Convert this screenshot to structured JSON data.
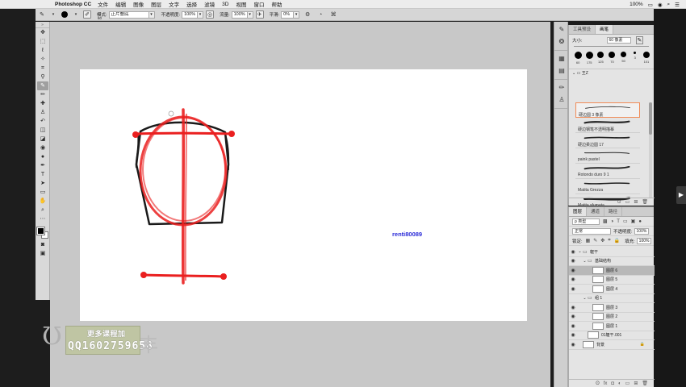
{
  "menubar": {
    "apple": "",
    "app": "Photoshop CC",
    "items": [
      "文件",
      "编辑",
      "图像",
      "图层",
      "文字",
      "选择",
      "滤镜",
      "3D",
      "视图",
      "窗口",
      "帮助"
    ],
    "battery": "100%",
    "status_icons": [
      "◉",
      "≡",
      "⌕",
      "☰"
    ]
  },
  "options": {
    "brush_size": "60",
    "mode_label": "模式:",
    "mode_value": "正片叠底",
    "opacity_label": "不透明度:",
    "opacity_value": "100%",
    "flow_label": "流量:",
    "flow_value": "100%",
    "smooth_label": "平滑:",
    "smooth_value": "0%"
  },
  "canvas": {
    "watermark": "renti80089"
  },
  "promo": {
    "line1": "更多课程加",
    "line2": "QQ1602759658"
  },
  "brush_panel": {
    "tabs": [
      "工具预设",
      "画笔"
    ],
    "active_tab": 1,
    "size_label": "大小:",
    "size_value": "60 像素",
    "presets": [
      {
        "size": "60",
        "d": 9
      },
      {
        "size": "175",
        "d": 9
      },
      {
        "size": "125",
        "d": 8
      },
      {
        "size": "70",
        "d": 8
      },
      {
        "size": "50",
        "d": 7
      },
      {
        "size": "3",
        "d": 3
      },
      {
        "size": "101",
        "d": 8
      }
    ],
    "folder": "王Z",
    "brushes": [
      {
        "name": "硬边圆 3 像素",
        "selected": true
      },
      {
        "name": "硬边钢笔不透明描摹",
        "selected": false
      },
      {
        "name": "硬边柔边圆 17",
        "selected": false
      },
      {
        "name": "paink pastel",
        "selected": false
      },
      {
        "name": "Rotondo duro 9 1",
        "selected": false
      },
      {
        "name": "Matita Grezza",
        "selected": false
      },
      {
        "name": "Matita sfumata",
        "selected": false
      }
    ]
  },
  "layers_panel": {
    "tabs": [
      "图层",
      "通道",
      "路径"
    ],
    "active_tab": 0,
    "filter_label": "ρ 类型",
    "blend_mode": "正常",
    "opacity_label": "不透明度:",
    "opacity_value": "100%",
    "lock_label": "锁定:",
    "fill_label": "填充:",
    "fill_value": "100%",
    "layers": [
      {
        "name": "躯干",
        "type": "group",
        "indent": 0,
        "visible": true,
        "selected": false
      },
      {
        "name": "基础结构",
        "type": "group",
        "indent": 1,
        "visible": true,
        "selected": false
      },
      {
        "name": "图层 6",
        "type": "layer",
        "indent": 2,
        "visible": true,
        "selected": true
      },
      {
        "name": "图层 5",
        "type": "layer",
        "indent": 2,
        "visible": true,
        "selected": false
      },
      {
        "name": "图层 4",
        "type": "layer",
        "indent": 2,
        "visible": true,
        "selected": false
      },
      {
        "name": "组 1",
        "type": "group",
        "indent": 1,
        "visible": false,
        "selected": false
      },
      {
        "name": "图层 3",
        "type": "layer",
        "indent": 2,
        "visible": true,
        "selected": false
      },
      {
        "name": "图层 2",
        "type": "layer",
        "indent": 2,
        "visible": true,
        "selected": false
      },
      {
        "name": "图层 1",
        "type": "layer",
        "indent": 2,
        "visible": true,
        "selected": false
      },
      {
        "name": "01躯干.001",
        "type": "layer",
        "indent": 1,
        "visible": true,
        "selected": false
      },
      {
        "name": "背景",
        "type": "layer",
        "indent": 0,
        "visible": true,
        "selected": false,
        "locked": true
      }
    ],
    "bottom_icons": [
      "ʘ",
      "fx",
      "◘",
      "◐",
      "▭",
      "⊞",
      "🗑"
    ]
  },
  "colors": {
    "stroke_red": "#ea1f1f",
    "stroke_black": "#1a1a1a",
    "watermark_blue": "#2a2ad8",
    "selection_orange": "#f08b57"
  }
}
